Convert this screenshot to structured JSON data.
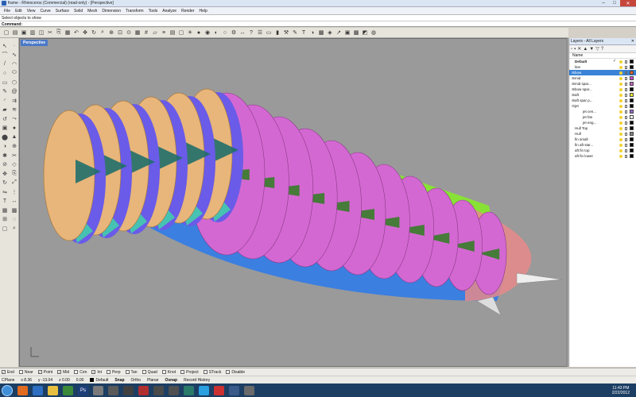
{
  "window": {
    "title": "frame - Rhinoceros (Commercial) (read-only) - [Perspective]",
    "minimize_icon": "minimize-icon",
    "maximize_icon": "maximize-icon",
    "close_icon": "close-icon"
  },
  "menu": [
    "File",
    "Edit",
    "View",
    "Curve",
    "Surface",
    "Solid",
    "Mesh",
    "Dimension",
    "Transform",
    "Tools",
    "Analyze",
    "Render",
    "Help"
  ],
  "command": {
    "history": "Select objects to show",
    "label": "Command:",
    "value": ""
  },
  "viewport": {
    "label": "Perspective"
  },
  "layers": {
    "title": "Layers - All Layers",
    "column": "Name",
    "rows": [
      {
        "name": "Default",
        "bold": true,
        "check": "✓",
        "expand": "",
        "color": "#000000",
        "selected": false
      },
      {
        "name": "line",
        "bold": false,
        "check": "",
        "expand": "",
        "color": "#000000",
        "selected": false
      },
      {
        "name": "bow",
        "bold": false,
        "check": "",
        "expand": "⊞",
        "color": "#e06030",
        "selected": true
      },
      {
        "name": "mid",
        "bold": false,
        "check": "",
        "expand": "⊞",
        "color": "#d050d0",
        "selected": false
      },
      {
        "name": "mid spar...",
        "bold": false,
        "check": "",
        "expand": "⊞",
        "color": "#c060c0",
        "selected": false
      },
      {
        "name": "bow spar...",
        "bold": false,
        "check": "",
        "expand": "⊞",
        "color": "#000000",
        "selected": false
      },
      {
        "name": "aft",
        "bold": false,
        "check": "",
        "expand": "⊞",
        "color": "#e8e830",
        "selected": false
      },
      {
        "name": "aft spar p...",
        "bold": false,
        "check": "",
        "expand": "⊞",
        "color": "#000000",
        "selected": false
      },
      {
        "name": "jet",
        "bold": false,
        "check": "",
        "expand": "⊟",
        "color": "#000000",
        "selected": false
      },
      {
        "name": "jet cen...",
        "bold": false,
        "check": "",
        "expand": "",
        "color": "#9966cc",
        "selected": false
      },
      {
        "name": "jet fan",
        "bold": false,
        "check": "",
        "expand": "",
        "color": "#ffffff",
        "selected": false
      },
      {
        "name": "jet eng...",
        "bold": false,
        "check": "",
        "expand": "",
        "color": "#000000",
        "selected": false
      },
      {
        "name": "Hull Top",
        "bold": false,
        "check": "",
        "expand": "",
        "color": "#000000",
        "selected": false
      },
      {
        "name": "Hull",
        "bold": false,
        "check": "",
        "expand": "",
        "color": "#808080",
        "selected": false
      },
      {
        "name": "fin small",
        "bold": false,
        "check": "",
        "expand": "",
        "color": "#000000",
        "selected": false
      },
      {
        "name": "fin aft star...",
        "bold": false,
        "check": "",
        "expand": "",
        "color": "#000000",
        "selected": false
      },
      {
        "name": "aft fin top",
        "bold": false,
        "check": "",
        "expand": "",
        "color": "#000000",
        "selected": false
      },
      {
        "name": "aft fin lower",
        "bold": false,
        "check": "",
        "expand": "",
        "color": "#000000",
        "selected": false
      }
    ]
  },
  "osnaps": [
    {
      "label": "End",
      "checked": true
    },
    {
      "label": "Near",
      "checked": false
    },
    {
      "label": "Point",
      "checked": true
    },
    {
      "label": "Mid",
      "checked": true
    },
    {
      "label": "Cen",
      "checked": false
    },
    {
      "label": "Int",
      "checked": true
    },
    {
      "label": "Perp",
      "checked": false
    },
    {
      "label": "Tan",
      "checked": false
    },
    {
      "label": "Quad",
      "checked": false
    },
    {
      "label": "Knot",
      "checked": false
    },
    {
      "label": "Project",
      "checked": false
    },
    {
      "label": "STrack",
      "checked": false
    },
    {
      "label": "Disable",
      "checked": false
    }
  ],
  "status": {
    "cplane": "CPlane",
    "x": "x 8.36",
    "y": "y -13.04",
    "z": "z 0.00",
    "dist": "0.00",
    "layer": "Default",
    "snap": "Snap",
    "ortho": "Ortho",
    "planar": "Planar",
    "osnap": "Osnap",
    "history": "Record History"
  },
  "clock": {
    "time": "11:43 PM",
    "date": "2/22/2012"
  },
  "colors": {
    "hull_tan": "#e8b57a",
    "rib_magenta": "#d468d2",
    "green": "#88e236",
    "dark_green": "#2d7f1e",
    "blue": "#3b7fe0",
    "purple": "#6a5be8",
    "teal": "#46c2b2",
    "nose": "#e88a8a"
  }
}
